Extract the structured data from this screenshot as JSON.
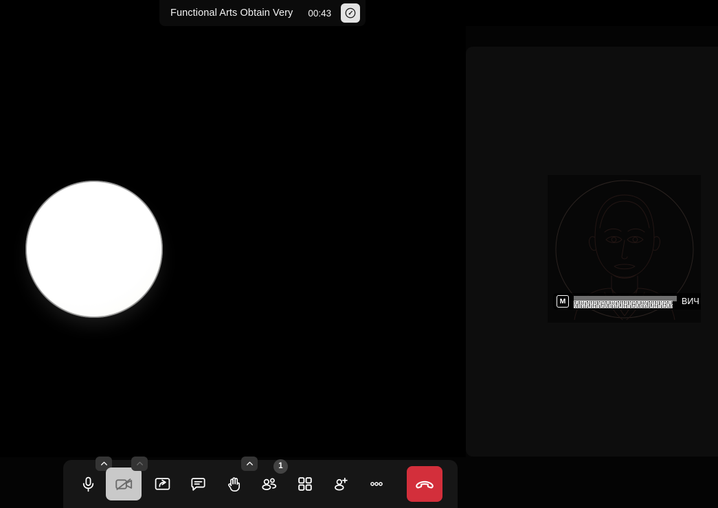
{
  "topbar": {
    "meeting_title": "Functional Arts Obtain Very",
    "timer": "00:43",
    "quality_icon": "gauge-icon"
  },
  "stage": {
    "avatar_icon": "blank-white-avatar"
  },
  "filmstrip": {
    "participant": {
      "avatar_icon": "person-silhouette-avatar",
      "mic_badge_label": "M",
      "name_redacted": true,
      "name_visible_tail": "ВИЧ"
    }
  },
  "toolbar": {
    "items": [
      {
        "name": "microphone-button",
        "icon": "microphone-icon",
        "label": "Microphone",
        "active": false,
        "has_chevron": true,
        "badge": null
      },
      {
        "name": "camera-button",
        "icon": "camera-off-icon",
        "label": "Camera",
        "active": true,
        "has_chevron": true,
        "badge": null
      },
      {
        "name": "share-screen-button",
        "icon": "share-screen-icon",
        "label": "Share screen",
        "active": false,
        "has_chevron": false,
        "badge": null
      },
      {
        "name": "chat-button",
        "icon": "chat-icon",
        "label": "Chat",
        "active": false,
        "has_chevron": false,
        "badge": null
      },
      {
        "name": "raise-hand-button",
        "icon": "raise-hand-icon",
        "label": "Raise hand",
        "active": false,
        "has_chevron": true,
        "badge": null
      },
      {
        "name": "participants-button",
        "icon": "participants-icon",
        "label": "Participants",
        "active": false,
        "has_chevron": false,
        "badge": "1"
      },
      {
        "name": "grid-view-button",
        "icon": "grid-view-icon",
        "label": "Layout",
        "active": false,
        "has_chevron": false,
        "badge": null
      },
      {
        "name": "add-participant-button",
        "icon": "add-person-icon",
        "label": "Invite",
        "active": false,
        "has_chevron": false,
        "badge": null
      },
      {
        "name": "more-options-button",
        "icon": "more-dots-icon",
        "label": "More",
        "active": false,
        "has_chevron": false,
        "badge": null
      }
    ],
    "hangup": {
      "name": "end-call-button",
      "icon": "phone-down-icon",
      "label": "Leave call"
    }
  },
  "colors": {
    "page_background": "#000000",
    "panel_background": "#0d0d0d",
    "toolbar_background": "#161616",
    "accent_danger": "#d32f3b",
    "active_button": "#c9c9c9",
    "text_primary": "#f2f2f2"
  }
}
